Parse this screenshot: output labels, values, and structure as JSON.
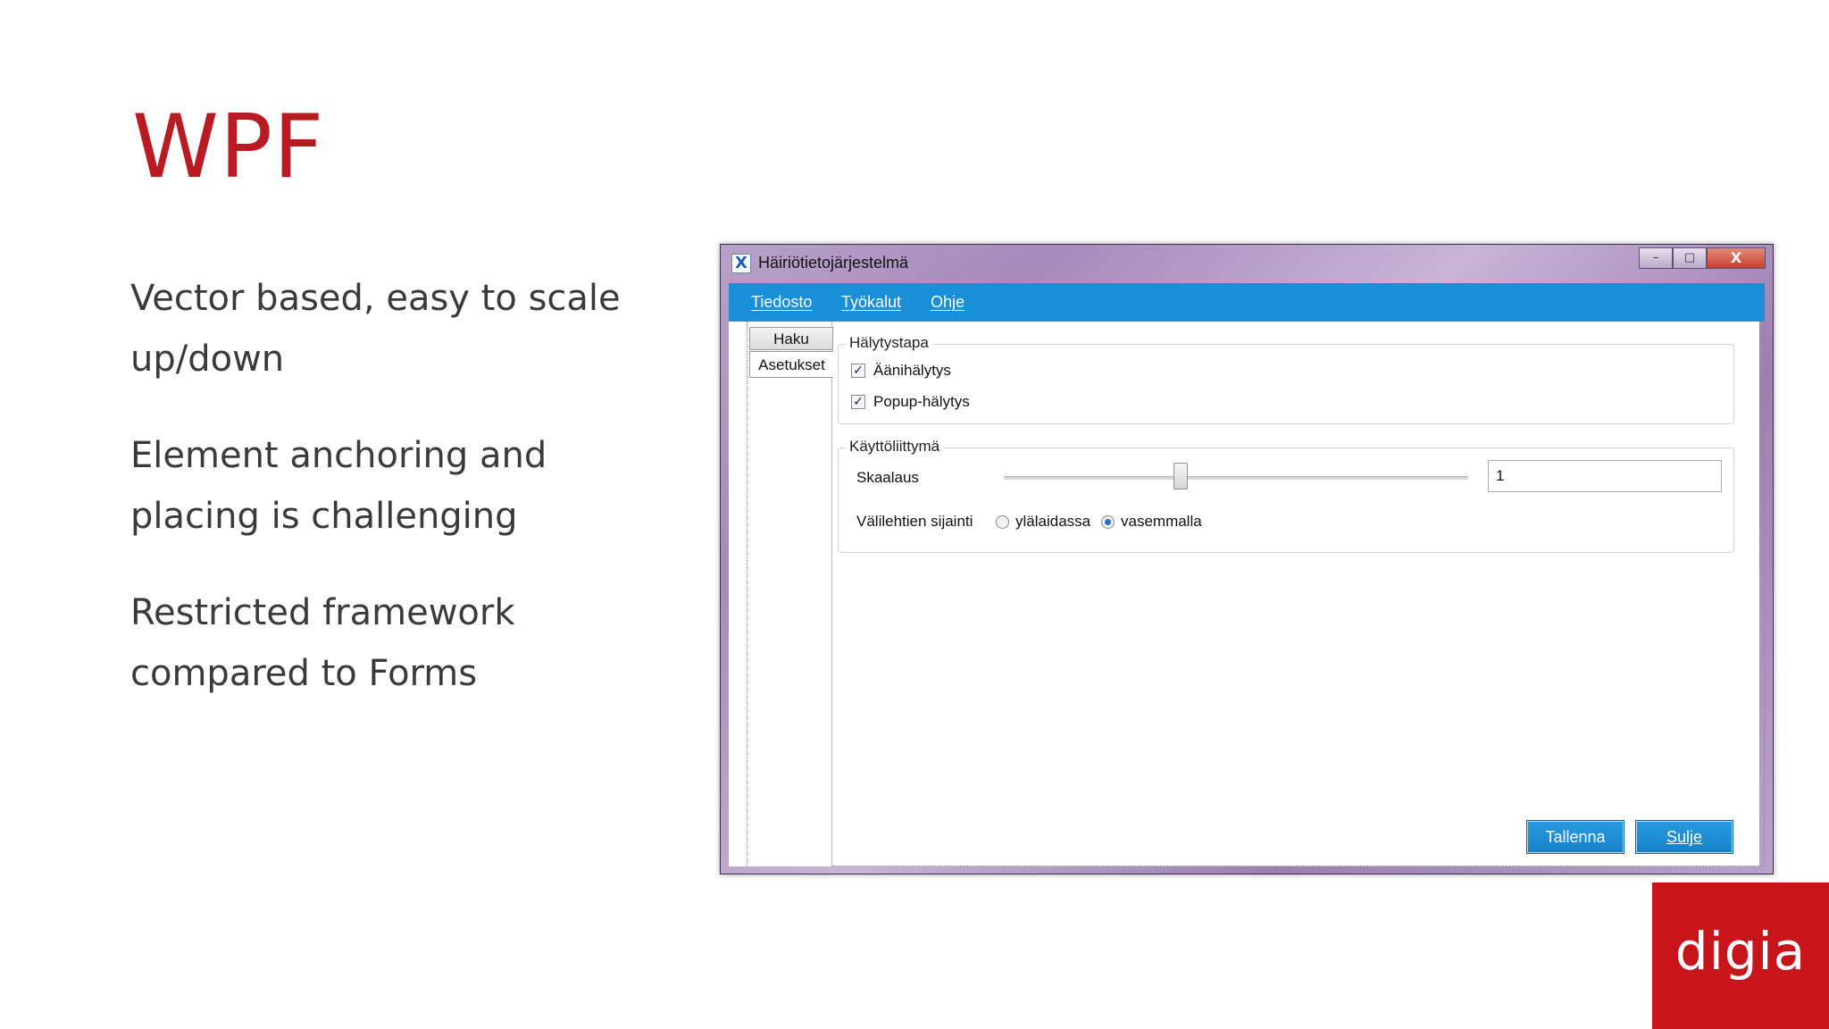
{
  "slide": {
    "title": "WPF",
    "bullets": [
      "Vector based, easy to scale up/down",
      "Element anchoring and placing is challenging",
      "Restricted framework compared to Forms"
    ],
    "logo_text": "digia"
  },
  "window": {
    "title": "Häiriötietojärjestelmä",
    "app_icon_glyph": "X",
    "caption": {
      "minimize": "–",
      "maximize": "□",
      "close": "X"
    },
    "menu": [
      "Tiedosto",
      "Työkalut",
      "Ohje"
    ],
    "tabs": [
      "Haku",
      "Asetukset"
    ],
    "alarm_group": {
      "title": "Hälytystapa",
      "sound_label": "Äänihälytys",
      "sound_checked": true,
      "popup_label": "Popup-hälytys",
      "popup_checked": true
    },
    "ui_group": {
      "title": "Käyttöliittymä",
      "scale_label": "Skaalaus",
      "scale_value": "1",
      "scale_slider_fraction": 0.38,
      "tab_position_label": "Välilehtien sijainti",
      "radio_options": [
        "ylälaidassa",
        "vasemmalla"
      ],
      "radio_selected": "vasemmalla"
    },
    "buttons": {
      "save": "Tallenna",
      "close": "Sulje"
    }
  },
  "colors": {
    "brand_red": "#c8151c",
    "title_red": "#b81c22",
    "menu_blue": "#1a8fd8",
    "button_blue": "#1680c9"
  }
}
